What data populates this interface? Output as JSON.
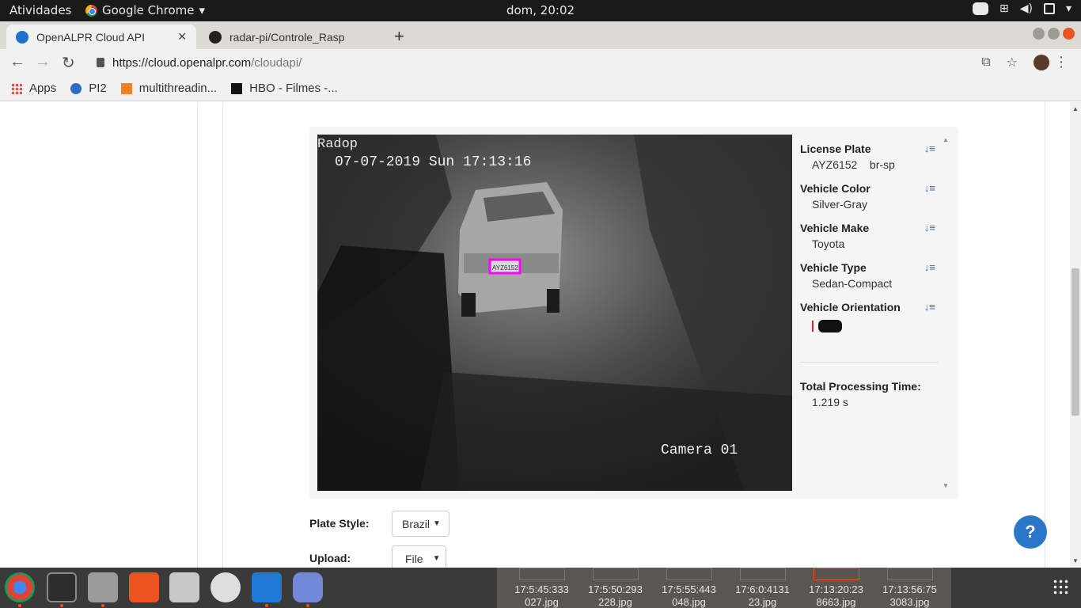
{
  "system": {
    "activities": "Atividades",
    "app_name": "Google Chrome",
    "clock": "dom, 20:02"
  },
  "tabs": [
    {
      "title": "OpenALPR Cloud API",
      "active": true
    },
    {
      "title": "radar-pi/Controle_Rasp",
      "active": false
    }
  ],
  "address": {
    "scheme_host": "https://cloud.openalpr.com",
    "path": "/cloudapi/"
  },
  "bookmarks": [
    {
      "label": "Apps",
      "icon": "apps-grid-icon"
    },
    {
      "label": "PI2",
      "icon": "pi2-icon"
    },
    {
      "label": "multithreadin...",
      "icon": "stackoverflow-icon"
    },
    {
      "label": "HBO - Filmes -...",
      "icon": "hbo-icon"
    }
  ],
  "photo": {
    "overlay_top_left": "Radop",
    "timestamp": "07-07-2019 Sun 17:13:16",
    "camera_label": "Camera 01",
    "plate_text": "AYZ6152",
    "plate_box_color": "#ff00ff"
  },
  "results": {
    "license_plate": {
      "label": "License Plate",
      "plate": "AYZ6152",
      "region": "br-sp"
    },
    "vehicle_color": {
      "label": "Vehicle Color",
      "value": "Silver-Gray"
    },
    "vehicle_make": {
      "label": "Vehicle Make",
      "value": "Toyota"
    },
    "vehicle_type": {
      "label": "Vehicle Type",
      "value": "Sedan-Compact"
    },
    "vehicle_orientation": {
      "label": "Vehicle Orientation"
    },
    "processing": {
      "label": "Total Processing Time:",
      "value": "1.219 s"
    }
  },
  "form": {
    "plate_style_label": "Plate Style:",
    "plate_style_value": "Brazil",
    "upload_label": "Upload:",
    "upload_value": "File"
  },
  "help_label": "?",
  "dock_thumbs": [
    {
      "line1": "17:5:45:333",
      "line2": "027.jpg"
    },
    {
      "line1": "17:5:50:293",
      "line2": "228.jpg"
    },
    {
      "line1": "17:5:55:443",
      "line2": "048.jpg"
    },
    {
      "line1": "17:6:0:4131",
      "line2": "23.jpg"
    },
    {
      "line1": "17:13:20:23",
      "line2": "8663.jpg"
    },
    {
      "line1": "17:13:56:75",
      "line2": "3083.jpg"
    }
  ],
  "colors": {
    "accent": "#2a6ebb",
    "ubuntu_orange": "#e95420",
    "help_button": "#2a77c9"
  }
}
